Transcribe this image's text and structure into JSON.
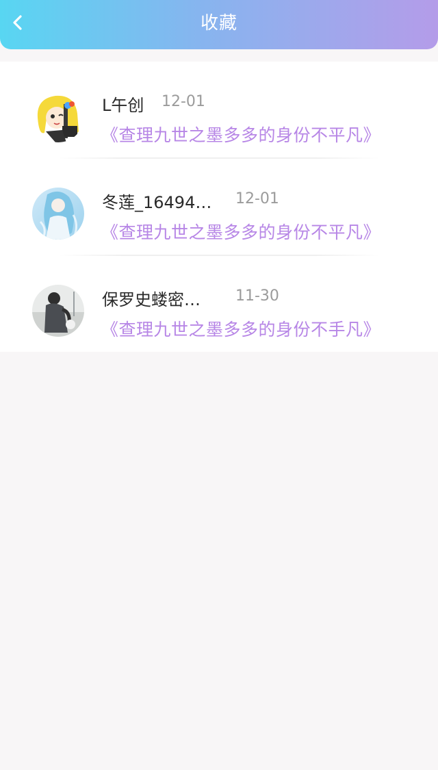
{
  "header": {
    "title": "收藏",
    "back_icon": "chevron-left-icon"
  },
  "colors": {
    "header_gradient_start": "#58d6f2",
    "header_gradient_end": "#b49ce9",
    "book_title": "#b786e6",
    "time": "#9b9b9b",
    "name": "#2a2a2a",
    "background": "#f8f6f7"
  },
  "favorites": [
    {
      "name": "L午创",
      "time": "12-01",
      "book": "《查理九世之墨多多的身份不平凡》",
      "avatar": "anime-avatar"
    },
    {
      "name": "冬莲_16494…",
      "time": "12-01",
      "book": "《查理九世之墨多多的身份不平凡》",
      "avatar": "anime-avatar"
    },
    {
      "name": "保罗史蝼密…",
      "time": "11-30",
      "book": "《查理九世之墨多多的身份不手凡》",
      "avatar": "photo-avatar"
    }
  ]
}
